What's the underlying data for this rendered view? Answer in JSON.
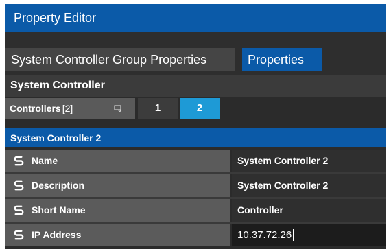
{
  "window": {
    "title": "Property Editor"
  },
  "tabs": [
    {
      "label": "System Controller Group Properties",
      "active": false
    },
    {
      "label": "Properties",
      "active": true
    }
  ],
  "section": {
    "title": "System Controller"
  },
  "controllers": {
    "label": "Controllers",
    "count": "[2]",
    "tabs": [
      "1",
      "2"
    ],
    "selected": "2"
  },
  "group": {
    "title": "System Controller 2"
  },
  "properties": [
    {
      "label": "Name",
      "value": "System Controller 2",
      "icon": "link-icon"
    },
    {
      "label": "Description",
      "value": "System Controller 2",
      "icon": "link-icon"
    },
    {
      "label": "Short Name",
      "value": "Controller",
      "icon": "link-icon"
    },
    {
      "label": "IP Address",
      "value": "10.37.72.26",
      "icon": "link-icon"
    }
  ],
  "colors": {
    "accent": "#0b5aa8",
    "selected_tab": "#1e9ad6",
    "panel_bg": "#2b2b2b",
    "label_bg": "#5b5b5b"
  }
}
